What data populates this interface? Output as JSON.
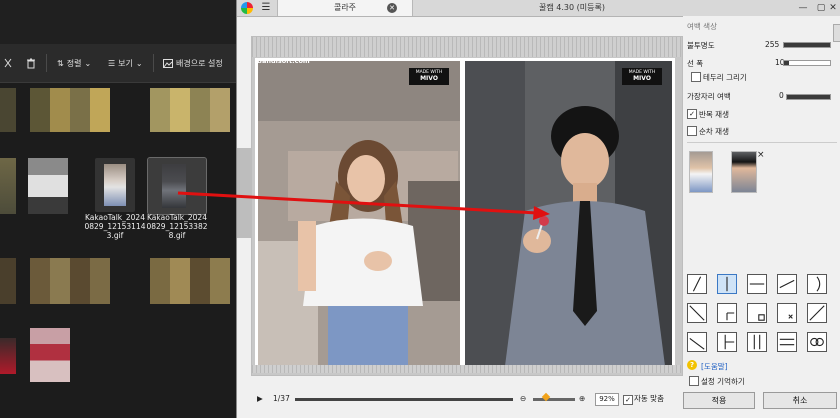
{
  "explorer": {
    "toolbar": {
      "sort_label": "정렬",
      "view_label": "보기",
      "wallpaper_label": "배경으로 설정"
    },
    "files": [
      {
        "name": "KakaoTalk_20240829_121531143.gif"
      },
      {
        "name": "KakaoTalk_20240829_121533828.gif"
      }
    ],
    "file_labels": [
      {
        "line1": "KakaoTalk_2024",
        "line2": "0829_12153114",
        "line3": "3.gif"
      },
      {
        "line1": "KakaoTalk_2024",
        "line2": "0829_12153382",
        "line3": "8.gif"
      }
    ]
  },
  "window": {
    "tab_title": "콜라주",
    "app_title": "꿀캠 4.30 (미등록)",
    "controls": {
      "minimize": "—",
      "close": "✕"
    }
  },
  "canvas": {
    "watermark": "Bandisoft.com",
    "made_with_line1": "MADE WITH",
    "made_with_line2": "MIVO"
  },
  "panel": {
    "top_cut_label": "여백 색상",
    "opacity_label": "불투명도",
    "opacity_value": "255",
    "opacity_fraction": 1.0,
    "line_label": "선 폭",
    "line_value": "10",
    "line_fraction": 0.1,
    "border_draw_label": "테두리 그리기",
    "border_draw_checked": false,
    "edge_margin_label": "가장자리 여백",
    "edge_margin_value": "0",
    "edge_margin_fraction": 0,
    "repeat_label": "반복 재생",
    "repeat_checked": true,
    "sequential_label": "순차 재생",
    "sequential_checked": false,
    "remove_icon": "×",
    "help_link": "[도움말]",
    "remember_label": "설정 기억하기",
    "remember_checked": false,
    "apply_button": "적용",
    "cancel_button": "취소"
  },
  "playback": {
    "frame_counter": "1/37",
    "zoom_level": "92%",
    "auto_fit_label": "자동 맞춤",
    "auto_fit_checked": true
  },
  "colors": {
    "accent": "#3b78c4",
    "arrow": "#e01010",
    "explorer_bg": "#1c1c1c",
    "window_bg": "#f0f0f0"
  }
}
